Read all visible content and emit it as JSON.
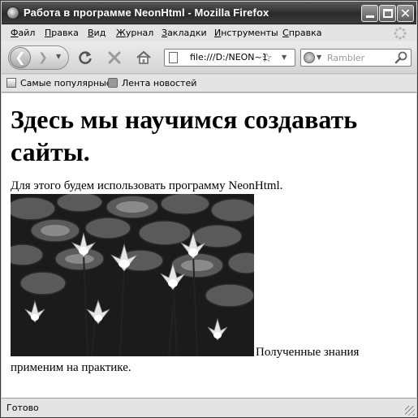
{
  "window": {
    "title": "Работа в программе NeonHtml - Mozilla Firefox"
  },
  "menu": {
    "items": [
      {
        "accel": "Ф",
        "rest": "айл"
      },
      {
        "accel": "П",
        "rest": "равка"
      },
      {
        "accel": "В",
        "rest": "ид"
      },
      {
        "accel": "Ж",
        "rest": "урнал"
      },
      {
        "accel": "З",
        "rest": "акладки"
      },
      {
        "accel": "И",
        "rest": "нструменты"
      },
      {
        "accel": "С",
        "rest": "правка"
      }
    ]
  },
  "navigation": {
    "url": "file:///D:/NEON~1",
    "search_placeholder": "Rambler"
  },
  "bookmarks": {
    "items": [
      "Самые популярные",
      "Лента новостей"
    ]
  },
  "page": {
    "heading": "Здесь мы научимся создавать сайты.",
    "intro": "Для этого будем использовать программу NeonHtml.",
    "after_image": "Полученные знания",
    "after_image_2": "применим на практике."
  },
  "status": {
    "text": "Готово"
  }
}
